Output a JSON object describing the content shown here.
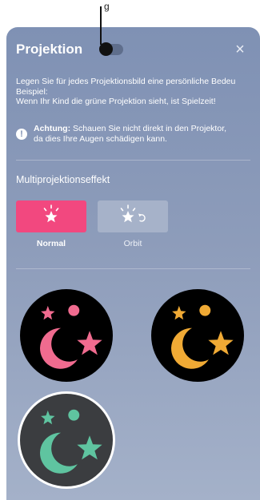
{
  "top_label": "g",
  "title": "Projektion",
  "close_glyph": "×",
  "description_lines": [
    "Legen Sie für jedes Projektionsbild eine persönliche Bedeu",
    "Beispiel:",
    "Wenn Ihr Kind die grüne Projektion sieht, ist Spielzeit!"
  ],
  "warning": {
    "icon": "exclamation-icon",
    "bold": "Achtung:",
    "line1": " Schauen Sie nicht direkt in den Projektor,",
    "line2": "da dies Ihre Augen schädigen kann."
  },
  "section_title": "Multiprojektionseffekt",
  "effects": [
    {
      "label": "Normal",
      "icon": "sparkle-star-icon",
      "selected": true
    },
    {
      "label": "Orbit",
      "icon": "sparkle-star-rotate-icon",
      "selected": false
    }
  ],
  "projections": [
    {
      "name": "pink",
      "color": "#f06b8f",
      "selected": false
    },
    {
      "name": "orange",
      "color": "#f0aa35",
      "selected": false
    },
    {
      "name": "green",
      "color": "#5fc4a0",
      "selected": true
    }
  ],
  "colors": {
    "panel_top": "#7f91b4",
    "accent_pink": "#f2487f",
    "orbit_button": "#a6b2c9"
  }
}
